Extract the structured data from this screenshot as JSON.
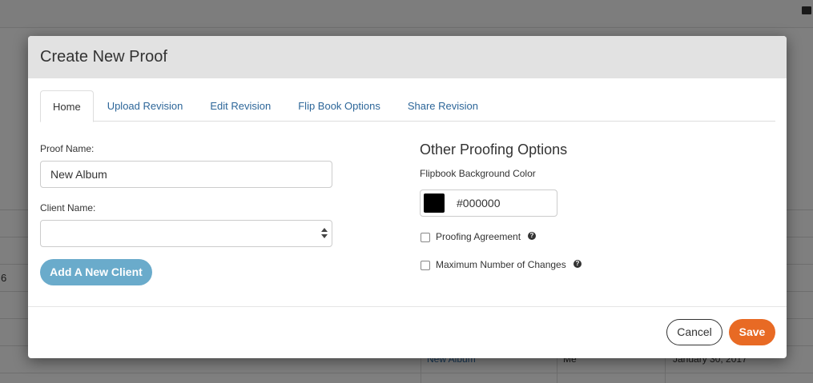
{
  "background": {
    "row_fragment": "6",
    "table_cells": [
      "New Album",
      "Me",
      "January 30, 2017"
    ]
  },
  "modal": {
    "title": "Create New Proof",
    "tabs": [
      {
        "label": "Home",
        "active": true
      },
      {
        "label": "Upload Revision",
        "active": false
      },
      {
        "label": "Edit Revision",
        "active": false
      },
      {
        "label": "Flip Book Options",
        "active": false
      },
      {
        "label": "Share Revision",
        "active": false
      }
    ],
    "form": {
      "proof_name_label": "Proof Name:",
      "proof_name_value": "New Album",
      "client_name_label": "Client Name:",
      "client_name_value": "",
      "add_client_label": "Add A New Client"
    },
    "options": {
      "title": "Other Proofing Options",
      "bg_color_label": "Flipbook Background Color",
      "bg_color_value": "#000000",
      "proofing_agreement_label": "Proofing Agreement",
      "proofing_agreement_checked": false,
      "max_changes_label": "Maximum Number of Changes",
      "max_changes_checked": false
    },
    "footer": {
      "cancel_label": "Cancel",
      "save_label": "Save"
    }
  },
  "icons": {
    "help": "help-circle-icon",
    "print": "print-icon",
    "select_arrows": "select-arrows-icon"
  },
  "colors": {
    "accent_save": "#e86a24",
    "add_client_button": "#6aabcb",
    "tab_link": "#2d6699",
    "header_bg": "#e2e2e2"
  }
}
